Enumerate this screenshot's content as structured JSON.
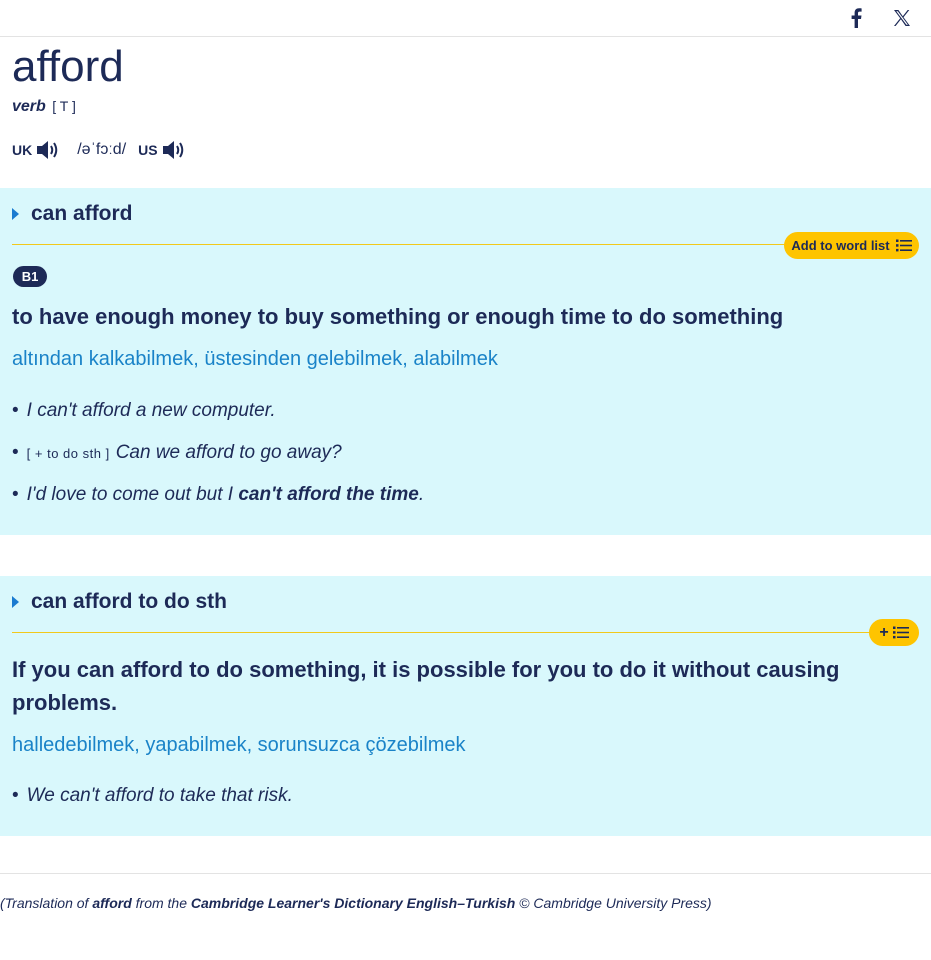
{
  "social": {
    "facebook_icon": "facebook-icon",
    "x_icon": "x-icon"
  },
  "entry": {
    "headword": "afford",
    "pos": "verb",
    "grammar": "[ T ]",
    "pron": {
      "uk_label": "UK",
      "ipa": "/əˈfɔːd/",
      "us_label": "US"
    }
  },
  "senses": [
    {
      "phrase": "can afford",
      "wordlist_label": "Add to word list",
      "level": "B1",
      "definition": "to have enough money to buy something or enough time to do something",
      "translation": "altından kalkabilmek, üstesinden gelebilmek, alabilmek",
      "examples": [
        {
          "bullet": "•",
          "text": "I can't afford a new computer."
        },
        {
          "bullet": "•",
          "code": "[ + to do sth ]",
          "text": "Can we afford to go away?"
        },
        {
          "bullet": "•",
          "text_pre": "I'd love to come out but I ",
          "text_bold": "can't afford the time",
          "text_post": "."
        }
      ]
    },
    {
      "phrase": "can afford to do sth",
      "wordlist_label": "+",
      "definition": "If you can afford to do something, it is possible for you to do it without causing problems.",
      "translation": "halledebilmek, yapabilmek, sorunsuzca çözebilmek",
      "examples": [
        {
          "bullet": "•",
          "text": "We can't afford to take that risk."
        }
      ]
    }
  ],
  "credit": {
    "p1": "(Translation of ",
    "word": "afford",
    "p2": " from the ",
    "dict": "Cambridge Learner's Dictionary English–Turkish",
    "p3": " © Cambridge University Press)"
  },
  "colors": {
    "navy": "#1d2a57",
    "cyan_bg": "#d9f8fc",
    "gold": "#fec400",
    "link_blue": "#1a83c8"
  }
}
